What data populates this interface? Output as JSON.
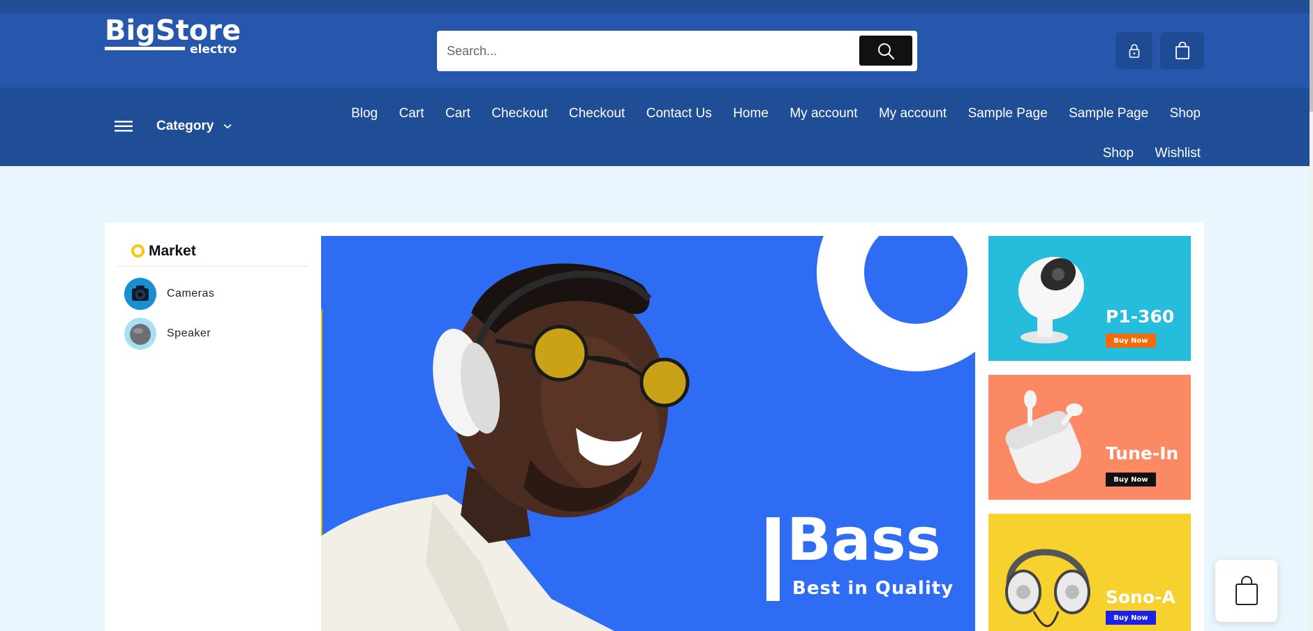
{
  "header": {
    "logo_main": "BigStore",
    "logo_sub": "electro",
    "search_placeholder": "Search..."
  },
  "nav": {
    "category_label": "Category",
    "menu": [
      "Blog",
      "Cart",
      "Cart",
      "Checkout",
      "Checkout",
      "Contact Us",
      "Home",
      "My account",
      "My account",
      "Sample Page",
      "Sample Page",
      "Shop",
      "Shop",
      "Wishlist"
    ]
  },
  "sidebar": {
    "title": "Market",
    "items": [
      {
        "label": "Cameras",
        "icon": "camera-thumb"
      },
      {
        "label": "Speaker",
        "icon": "speaker-thumb"
      }
    ]
  },
  "hero": {
    "title": "Bass",
    "subtitle": "Best in Quality"
  },
  "promos": [
    {
      "name": "P1-360",
      "button": "Buy Now",
      "bg": "#26bcdc",
      "button_bg": "#f36b0b"
    },
    {
      "name": "Tune-In",
      "button": "Buy Now",
      "bg": "#fb8a64",
      "button_bg": "#111111"
    },
    {
      "name": "Sono-A",
      "button": "Buy Now",
      "bg": "#f7d12e",
      "button_bg": "#1b22e6"
    }
  ],
  "colors": {
    "header": "#2657ad",
    "nav": "#1f4e97",
    "page_bg": "#eaf6fd",
    "hero_bg": "#2d6cf3",
    "accent_yellow": "#f6c90e"
  }
}
